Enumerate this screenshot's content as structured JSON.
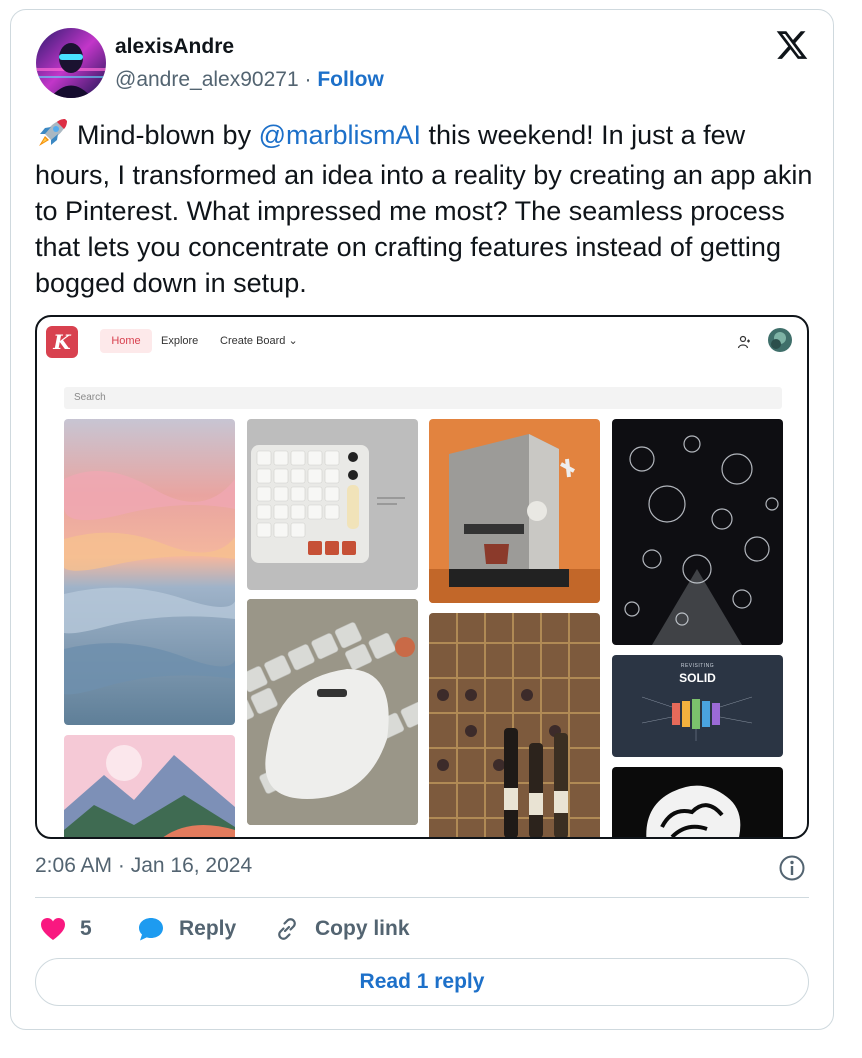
{
  "author": {
    "name": "alexisAndre",
    "handle": "@andre_alex90271",
    "separator": "·",
    "follow_label": "Follow"
  },
  "tweet": {
    "text_before": "Mind-blown by ",
    "mention": "@marblismAI",
    "text_after": " this weekend! In just a few hours, I transformed an idea into a reality by creating an app akin to Pinterest. What impressed me most? The seamless process that lets you concentrate on crafting features instead of getting bogged down in setup.",
    "emoji_icon": "rocket-icon"
  },
  "media": {
    "app_logo": "K",
    "nav": {
      "home": "Home",
      "explore": "Explore",
      "create_board": "Create Board"
    },
    "search_placeholder": "Search",
    "card": {
      "small_label": "REVISITING",
      "title": "SOLID"
    }
  },
  "timestamp": "2:06 AM · Jan 16, 2024",
  "actions": {
    "likes": "5",
    "reply": "Reply",
    "copy_link": "Copy link"
  },
  "read_reply_label": "Read 1 reply",
  "colors": {
    "accent": "#1d70c9",
    "like": "#f91880",
    "brand": "#d8414f"
  }
}
